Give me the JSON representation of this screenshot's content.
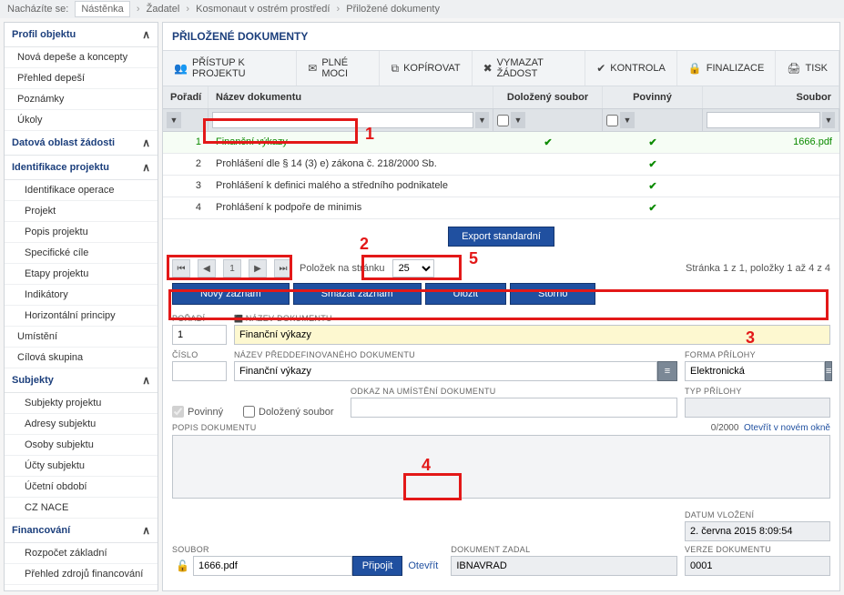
{
  "breadcrumb": {
    "label": "Nacházíte se:",
    "items": [
      "Nástěnka",
      "Žadatel",
      "Kosmonaut v ostrém prostředí",
      "Přiložené dokumenty"
    ]
  },
  "sidebar": {
    "s1_title": "Profil objektu",
    "s1_items": [
      "Nová depeše a koncepty",
      "Přehled depeší",
      "Poznámky",
      "Úkoly"
    ],
    "s2_title": "Datová oblast žádosti",
    "s3_title": "Identifikace projektu",
    "s3_items": [
      "Identifikace operace",
      "Projekt",
      "Popis projektu",
      "Specifické cíle",
      "Etapy projektu",
      "Indikátory",
      "Horizontální principy"
    ],
    "s4a": "Umístění",
    "s4b": "Cílová skupina",
    "s5_title": "Subjekty",
    "s5_items": [
      "Subjekty projektu",
      "Adresy subjektu",
      "Osoby subjektu",
      "Účty subjektu",
      "Účetní období",
      "CZ NACE"
    ],
    "s6_title": "Financování",
    "s6_items": [
      "Rozpočet základní",
      "Přehled zdrojů financování"
    ]
  },
  "panelTitle": "PŘILOŽENÉ DOKUMENTY",
  "tools": {
    "pristup": "PŘÍSTUP K PROJEKTU",
    "plnemoci": "PLNÉ MOCI",
    "kopirovat": "KOPÍROVAT",
    "vymazat": "VYMAZAT ŽÁDOST",
    "kontrola": "KONTROLA",
    "finalizace": "FINALIZACE",
    "tisk": "TISK"
  },
  "gridHead": {
    "poradi": "Pořadí",
    "nazev": "Název dokumentu",
    "dolozeny": "Doložený soubor",
    "povinny": "Povinný",
    "soubor": "Soubor"
  },
  "gridRows": [
    {
      "poradi": "1",
      "nazev": "Finanční výkazy",
      "dolozeny": true,
      "povinny": true,
      "soubor": "1666.pdf"
    },
    {
      "poradi": "2",
      "nazev": "Prohlášení dle § 14 (3) e) zákona č. 218/2000 Sb.",
      "dolozeny": false,
      "povinny": true,
      "soubor": ""
    },
    {
      "poradi": "3",
      "nazev": "Prohlášení k definici malého a středního podnikatele",
      "dolozeny": false,
      "povinny": true,
      "soubor": ""
    },
    {
      "poradi": "4",
      "nazev": "Prohlášení k podpoře de minimis",
      "dolozeny": false,
      "povinny": true,
      "soubor": ""
    }
  ],
  "exportBtn": "Export standardní",
  "pager": {
    "pageLabel": "Položek na stránku",
    "pageSize": "25",
    "current": "1",
    "summary": "Stránka 1 z 1, položky 1 až 4 z 4"
  },
  "actions": {
    "novy": "Nový záznam",
    "smazat": "Smazat záznam",
    "ulozit": "Uložit",
    "storno": "Storno"
  },
  "form": {
    "poradiLabel": "POŘADÍ",
    "poradiVal": "1",
    "nazevLabel": "NÁZEV DOKUMENTU",
    "nazevVal": "Finanční výkazy",
    "cisloLabel": "ČÍSLO",
    "cisloVal": "",
    "preddefLabel": "NÁZEV PŘEDDEFINOVANÉHO DOKUMENTU",
    "preddefVal": "Finanční výkazy",
    "formaLabel": "FORMA PŘÍLOHY",
    "formaVal": "Elektronická",
    "povinnyLabel": "Povinný",
    "dolozenyLabel": "Doložený soubor",
    "odkazLabel": "ODKAZ NA UMÍSTĚNÍ DOKUMENTU",
    "odkazVal": "",
    "typLabel": "TYP PŘÍLOHY",
    "typVal": "",
    "popisLabel": "POPIS DOKUMENTU",
    "popisCounter": "0/2000",
    "popisOpen": "Otevřít v novém okně",
    "souborLabel": "SOUBOR",
    "souborVal": "1666.pdf",
    "pripojit": "Připojit",
    "otevrit": "Otevřít",
    "dokZadalLabel": "DOKUMENT ZADAL",
    "dokZadalVal": "IBNAVRAD",
    "datumLabel": "DATUM VLOŽENÍ",
    "datumVal": "2. června 2015 8:09:54",
    "verzeLabel": "VERZE DOKUMENTU",
    "verzeVal": "0001"
  }
}
